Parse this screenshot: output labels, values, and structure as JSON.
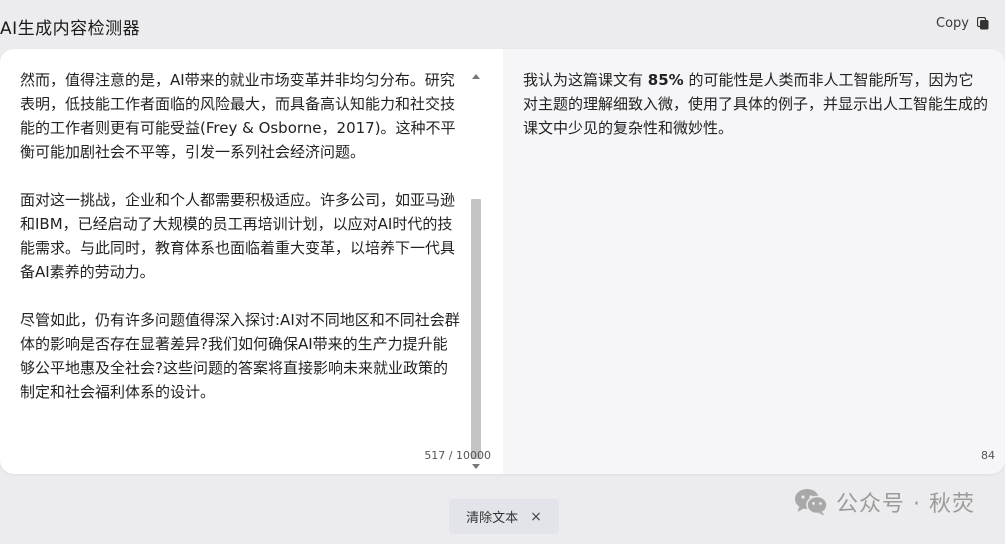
{
  "header": {
    "title": "AI生成内容检测器",
    "copy_label": "Copy"
  },
  "input": {
    "paragraphs": [
      "然而，值得注意的是，AI带来的就业市场变革并非均匀分布。研究表明，低技能工作者面临的风险最大，而具备高认知能力和社交技能的工作者则更有可能受益(Frey & Osborne，2017)。这种不平衡可能加剧社会不平等，引发一系列社会经济问题。",
      "面对这一挑战，企业和个人都需要积极适应。许多公司，如亚马逊和IBM，已经启动了大规模的员工再培训计划，以应对AI时代的技能需求。与此同时，教育体系也面临着重大变革，以培养下一代具备AI素养的劳动力。",
      "尽管如此，仍有许多问题值得深入探讨:AI对不同地区和不同社会群体的影响是否存在显著差异?我们如何确保AI带来的生产力提升能够公平地惠及全社会?这些问题的答案将直接影响未来就业政策的制定和社会福利体系的设计。"
    ],
    "char_count": "517 / 10000"
  },
  "result": {
    "text_before": "我认为这篇课文有 ",
    "percentage": "85%",
    "text_after": " 的可能性是人类而非人工智能所写，因为它对主题的理解细致入微，使用了具体的例子，并显示出人工智能生成的课文中少见的复杂性和微妙性。",
    "word_count": "84"
  },
  "footer": {
    "clear_label": "清除文本",
    "clear_icon": "×",
    "watermark": "公众号 · 秋荧"
  },
  "icons": {
    "copy": "copy-icon",
    "close": "close-icon",
    "wechat": "wechat-icon"
  }
}
